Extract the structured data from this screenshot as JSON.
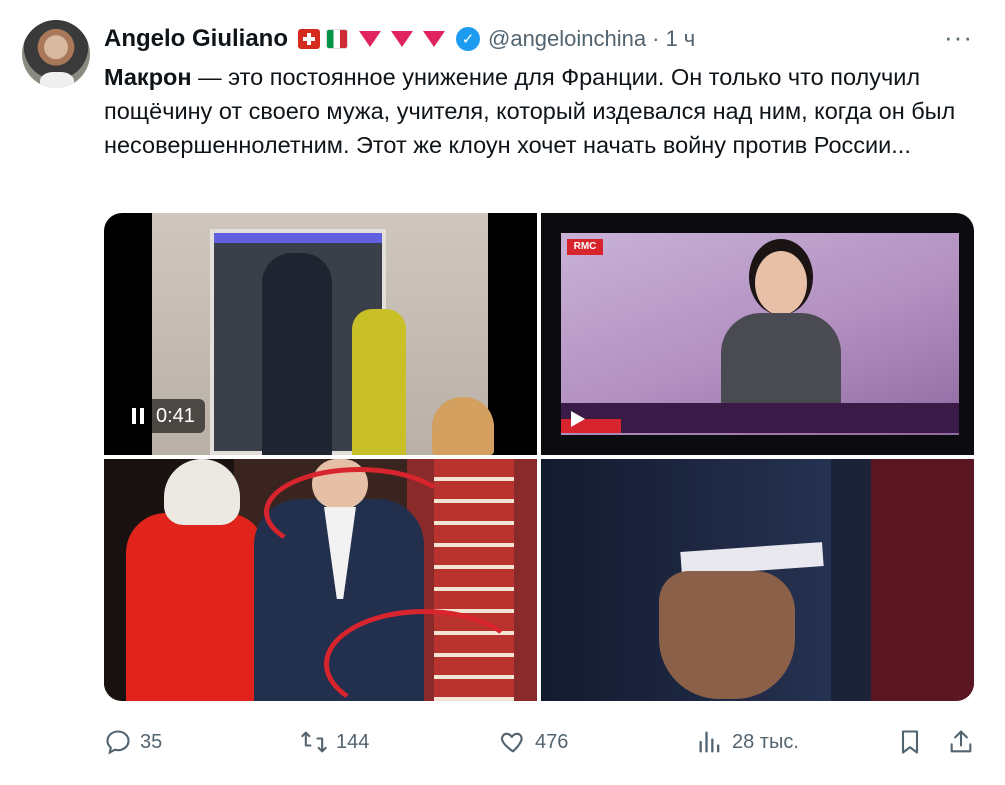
{
  "tweet": {
    "display_name": "Angelo Giuliano",
    "handle": "@angeloinchina",
    "separator": "·",
    "time": "1 ч",
    "more_label": "···",
    "text_bold": "Макрон",
    "text_rest": " — это постоянное унижение для Франции. Он только что получил пощёчину от своего мужа, учителя, который издевался над ним, когда он был несовершеннолетним. Этот же клоун хочет начать войну против России...",
    "badges": [
      "flag-switzerland-icon",
      "flag-italy-icon",
      "red-triangle-icon",
      "red-triangle-icon",
      "red-triangle-icon",
      "verified-badge-icon"
    ]
  },
  "media": {
    "video_duration": "0:41",
    "tv_logo": "RMC"
  },
  "actions": {
    "replies": "35",
    "retweets": "144",
    "likes": "476",
    "views": "28 тыс."
  },
  "colors": {
    "accent": "#1d9bf0",
    "text_primary": "#0f1419",
    "text_secondary": "#536471"
  }
}
